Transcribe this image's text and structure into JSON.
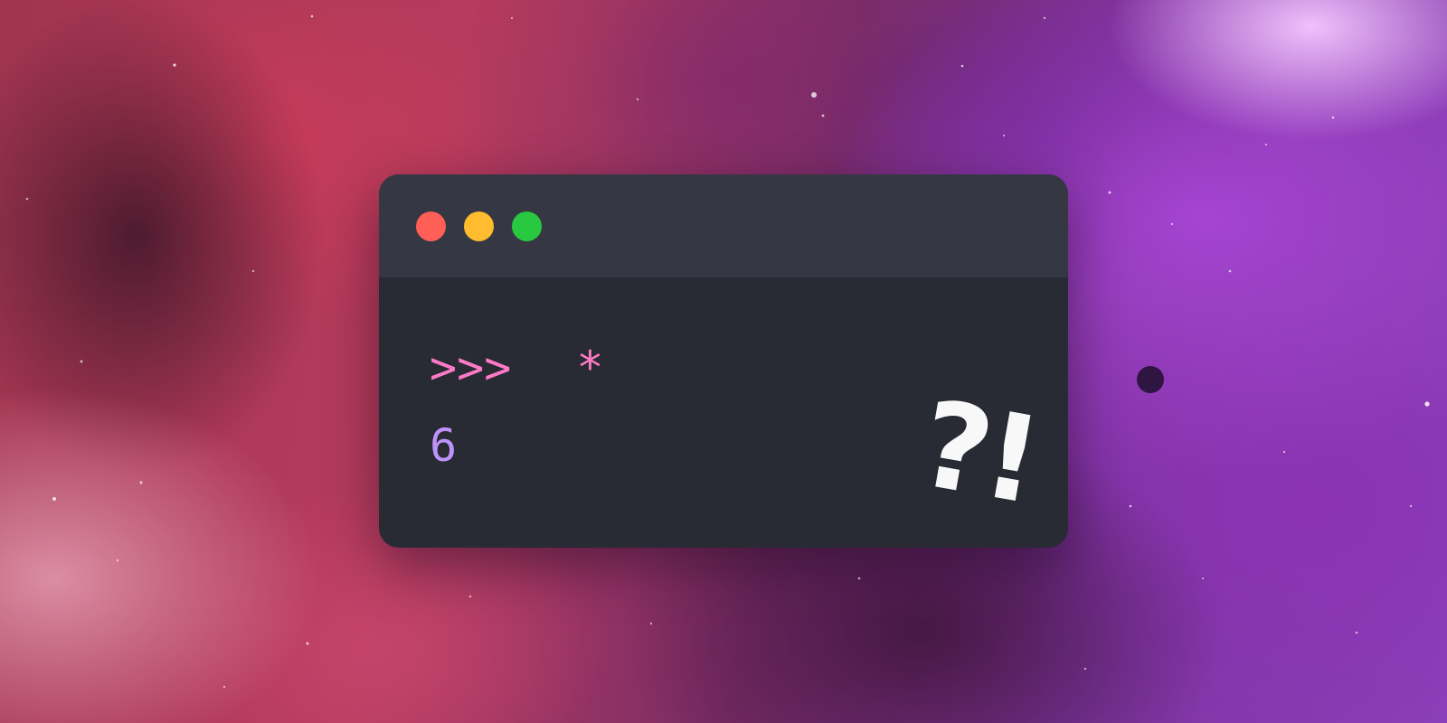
{
  "window": {
    "controls": [
      {
        "name": "close",
        "color": "#ff5f57"
      },
      {
        "name": "minimize",
        "color": "#febc2e"
      },
      {
        "name": "zoom",
        "color": "#28c840"
      }
    ]
  },
  "console": {
    "prompt": ">>>",
    "operator": "*",
    "output": "6"
  },
  "overlay": {
    "text": "?!"
  },
  "colors": {
    "prompt": "#ff7ac6",
    "output": "#bd93f9",
    "terminal_background": "#282a34",
    "titlebar_background": "#353743"
  }
}
